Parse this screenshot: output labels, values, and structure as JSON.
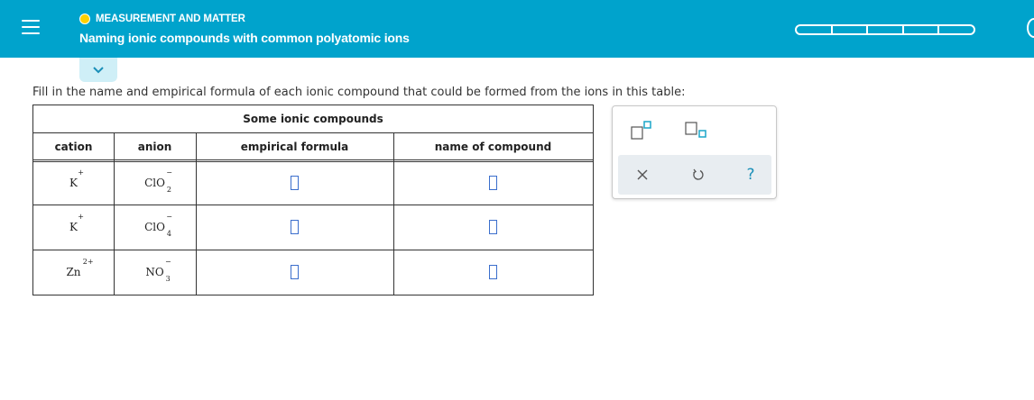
{
  "header": {
    "topic": "MEASUREMENT AND MATTER",
    "title": "Naming ionic compounds with common polyatomic ions",
    "progress_segments": 5
  },
  "instruction": "Fill in the name and empirical formula of each ionic compound that could be formed from the ions in this table:",
  "table": {
    "caption": "Some ionic compounds",
    "headers": {
      "cation": "cation",
      "anion": "anion",
      "formula": "empirical formula",
      "name": "name of compound"
    },
    "rows": [
      {
        "cation": {
          "symbol": "K",
          "charge": "+"
        },
        "anion": {
          "symbol": "ClO",
          "subscript": "2",
          "charge": "−"
        }
      },
      {
        "cation": {
          "symbol": "K",
          "charge": "+"
        },
        "anion": {
          "symbol": "ClO",
          "subscript": "4",
          "charge": "−"
        }
      },
      {
        "cation": {
          "symbol": "Zn",
          "charge": "2+"
        },
        "anion": {
          "symbol": "NO",
          "subscript": "3",
          "charge": "−"
        }
      }
    ]
  },
  "palette": {
    "tools": [
      "superscript-tool",
      "subscript-tool"
    ],
    "actions": {
      "clear": "×",
      "undo": "↺",
      "help": "?"
    }
  },
  "colors": {
    "header_bg": "#00a3cc",
    "topic_dot": "#ffd000",
    "answer_box_border": "#3b6ecc",
    "palette_bar": "#e8edf1",
    "tool_accent": "#1aa6c8"
  }
}
